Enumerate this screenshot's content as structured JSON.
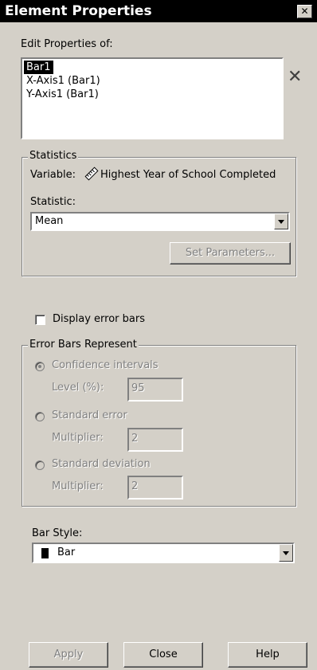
{
  "window": {
    "title": "Element Properties",
    "close_glyph": "✕"
  },
  "edit_properties": {
    "label": "Edit Properties of:",
    "items": [
      "Bar1",
      "X-Axis1 (Bar1)",
      "Y-Axis1 (Bar1)"
    ],
    "selected_index": 0,
    "delete_icon_glyph": "✕"
  },
  "statistics": {
    "group_label": "Statistics",
    "variable_label": "Variable:",
    "variable_value": "Highest Year of School Completed",
    "statistic_label": "Statistic:",
    "statistic_value": "Mean",
    "set_parameters_label": "Set Parameters..."
  },
  "error_bars": {
    "display_label": "Display error bars",
    "display_checked": false,
    "group_label": "Error Bars Represent",
    "confidence_label": "Confidence intervals",
    "level_label": "Level (%):",
    "level_value": "95",
    "std_error_label": "Standard error",
    "multiplier_label_1": "Multiplier:",
    "multiplier_value_1": "2",
    "std_deviation_label": "Standard deviation",
    "multiplier_label_2": "Multiplier:",
    "multiplier_value_2": "2",
    "selected": "Confidence intervals"
  },
  "bar_style": {
    "label": "Bar Style:",
    "value": "Bar"
  },
  "footer": {
    "apply_label": "Apply",
    "close_label": "Close",
    "help_label": "Help"
  },
  "colors": {
    "title_bg": "#000000",
    "dialog_bg": "#d4d0c8",
    "selection_bg": "#000000",
    "disabled_text": "#808080"
  }
}
